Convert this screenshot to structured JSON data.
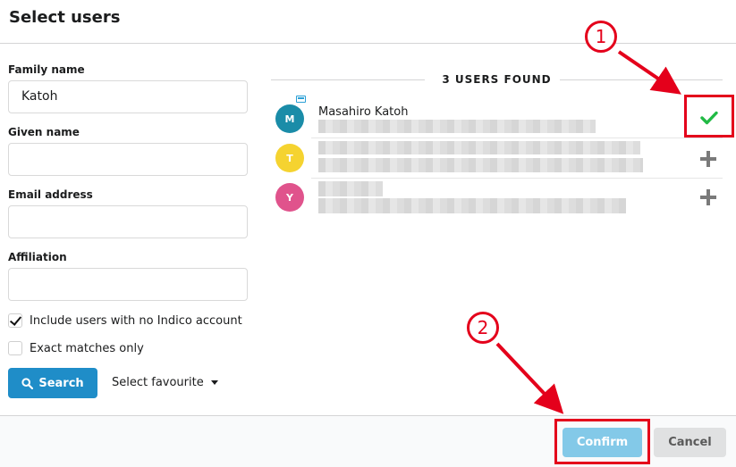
{
  "dialog": {
    "title": "Select users"
  },
  "form": {
    "family_name_label": "Family name",
    "family_name_value": "Katoh",
    "given_name_label": "Given name",
    "given_name_value": "",
    "email_label": "Email address",
    "email_value": "",
    "affiliation_label": "Affiliation",
    "affiliation_value": "",
    "include_no_account_label": "Include users with no Indico account",
    "include_no_account_checked": true,
    "exact_matches_label": "Exact matches only",
    "exact_matches_checked": false,
    "search_label": "Search",
    "favourite_label": "Select favourite"
  },
  "results": {
    "heading": "3 USERS FOUND",
    "users": [
      {
        "initial": "M",
        "name": "Masahiro Katoh",
        "avatar_color": "#1a8ca8",
        "action": "selected"
      },
      {
        "initial": "T",
        "name": "",
        "avatar_color": "#f5d330",
        "action": "add"
      },
      {
        "initial": "Y",
        "name": "",
        "avatar_color": "#e0538c",
        "action": "add"
      }
    ]
  },
  "footer": {
    "confirm_label": "Confirm",
    "cancel_label": "Cancel"
  },
  "annotations": {
    "step1": "1",
    "step2": "2",
    "color": "#e4001b"
  }
}
